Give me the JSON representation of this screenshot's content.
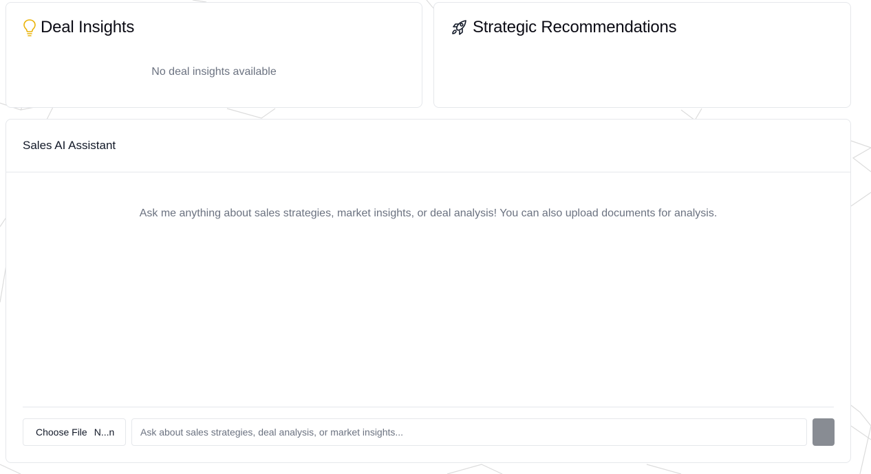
{
  "insights": {
    "title": "Deal Insights",
    "icon": "lightbulb-icon",
    "icon_color": "#eab308",
    "empty_message": "No deal insights available"
  },
  "recommendations": {
    "title": "Strategic Recommendations",
    "icon": "rocket-icon"
  },
  "assistant": {
    "title": "Sales AI Assistant",
    "empty_message": "Ask me anything about sales strategies, market insights, or deal analysis! You can also upload documents for analysis.",
    "file_button_label": "Choose File",
    "file_name": "N...n",
    "input_placeholder": "Ask about sales strategies, deal analysis, or market insights...",
    "send_button_color": "#888c93"
  }
}
